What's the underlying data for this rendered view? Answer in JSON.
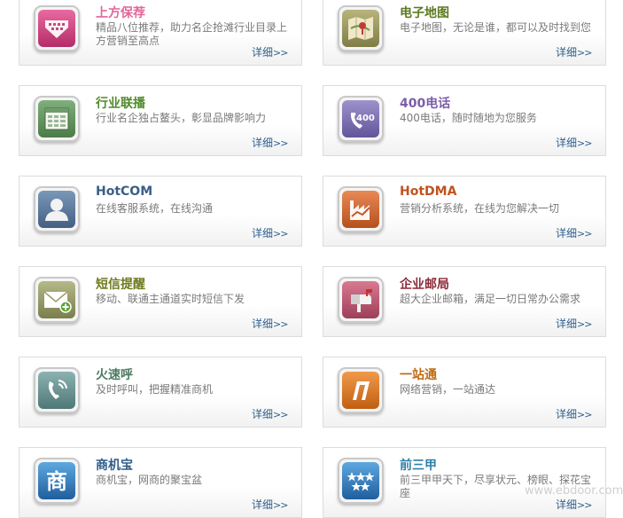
{
  "more_label": "详细",
  "more_arrow": ">>",
  "watermark": "www.ebdoor.com",
  "services": [
    {
      "title": "上方保荐",
      "desc": "精品八位推荐，助力名企抢滩行业目录上方营销至高点",
      "title_color": "#e0679a",
      "icon": "download-arrow-icon"
    },
    {
      "title": "电子地图",
      "desc": "电子地图，无论是谁，都可以及时找到您",
      "title_color": "#5b7a1f",
      "icon": "map-pin-icon"
    },
    {
      "title": "行业联播",
      "desc": "行业名企独占鳌头，彰显品牌影响力",
      "title_color": "#4f8a2b",
      "icon": "grid-window-icon"
    },
    {
      "title": "400电话",
      "desc": "400电话，随时随地为您服务",
      "title_color": "#7b5ea8",
      "icon": "phone-400-icon"
    },
    {
      "title": "HotCOM",
      "desc": "在线客服系统，在线沟通",
      "title_color": "#3a5f86",
      "icon": "user-silhouette-icon"
    },
    {
      "title": "HotDMA",
      "desc": "营销分析系统，在线为您解决一切",
      "title_color": "#c0531f",
      "icon": "factory-chart-icon"
    },
    {
      "title": "短信提醒",
      "desc": "移动、联通主通道实时短信下发",
      "title_color": "#6e7a1e",
      "icon": "envelope-plus-icon"
    },
    {
      "title": "企业邮局",
      "desc": "超大企业邮箱，满足一切日常办公需求",
      "title_color": "#8a2a3a",
      "icon": "mailbox-icon"
    },
    {
      "title": "火速呼",
      "desc": "及时呼叫，把握精准商机",
      "title_color": "#4d7a62",
      "icon": "phone-call-icon"
    },
    {
      "title": "一站通",
      "desc": "网络营销，一站通达",
      "title_color": "#c06a12",
      "icon": "one-stop-icon"
    },
    {
      "title": "商机宝",
      "desc": "商机宝，网商的聚宝盆",
      "title_color": "#2f5c8a",
      "icon": "shang-character-icon"
    },
    {
      "title": "前三甲",
      "desc": "前三甲甲天下，尽享状元、榜眼、探花宝座",
      "title_color": "#2f7fa8",
      "icon": "stars-icon"
    }
  ],
  "icon_symbols": {
    "shang": "商",
    "phone_400": "400"
  }
}
